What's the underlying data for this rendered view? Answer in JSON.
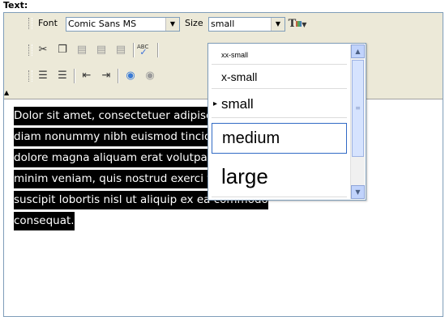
{
  "field_label": "Text:",
  "toolbar": {
    "font_label": "Font",
    "font_value": "Comic Sans MS",
    "size_label": "Size",
    "size_value": "small",
    "row2_icons": [
      "cut-icon",
      "copy-icon",
      "paste-icon",
      "paste-text-icon",
      "paste-word-icon",
      "spellcheck-icon"
    ],
    "row3_icons": [
      "numbered-list-icon",
      "bulleted-list-icon",
      "outdent-icon",
      "indent-icon",
      "link-icon",
      "unlink-icon"
    ]
  },
  "size_dropdown": {
    "options": [
      {
        "label": "xx-small",
        "current": false
      },
      {
        "label": "x-small",
        "current": false
      },
      {
        "label": "small",
        "current": true
      },
      {
        "label": "medium",
        "current": false
      },
      {
        "label": "large",
        "current": false
      }
    ]
  },
  "content": {
    "lines": [
      "Dolor sit amet, consectetuer adipiscing elit, sed",
      "diam nonummy nibh euismod tincidunt ut laoreet",
      "dolore magna aliquam erat volutpat. Ut wisi enim ad",
      "minim veniam, quis nostrud exerci tation ullamcorper",
      "suscipit lobortis nisl ut aliquip ex ea commodo",
      "consequat."
    ],
    "highlight_color": "#000000",
    "text_color": "#ffffff"
  }
}
